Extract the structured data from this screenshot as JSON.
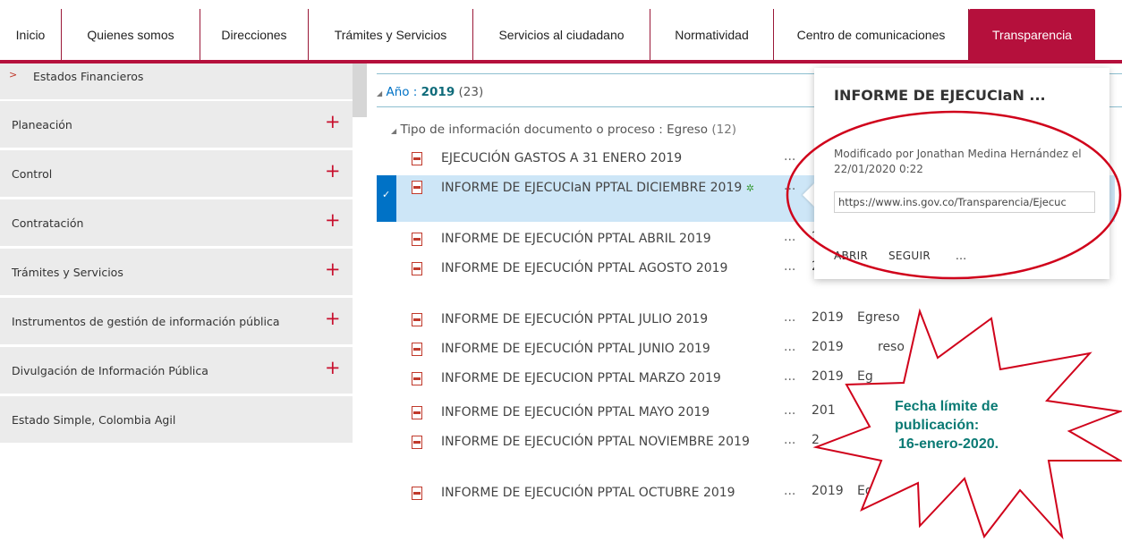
{
  "nav": {
    "items": [
      "Inicio",
      "Quienes somos",
      "Direcciones",
      "Trámites y Servicios",
      "Servicios al ciudadano",
      "Normatividad",
      "Centro de comunicaciones",
      "Transparencia"
    ],
    "active": "Transparencia",
    "accent_color": "#b5103c"
  },
  "sidebar": {
    "first": {
      "arrow": ">",
      "label": "Estados Financieros"
    },
    "items": [
      {
        "label": "Planeación",
        "expand": "+"
      },
      {
        "label": "Control",
        "expand": "+"
      },
      {
        "label": "Contratación",
        "expand": "+"
      },
      {
        "label": "Trámites y Servicios",
        "expand": "+"
      },
      {
        "label": "Instrumentos de gestión de información pública",
        "expand": "+"
      },
      {
        "label": "Divulgación de Información Pública",
        "expand": "+"
      },
      {
        "label": "Estado Simple, Colombia Agil",
        "expand": ""
      }
    ]
  },
  "list": {
    "year_group": {
      "caret": "◢",
      "label": "Año :",
      "value": "2019",
      "count": "(23)"
    },
    "type_group": {
      "caret": "◢",
      "text": "Tipo de información documento o proceso : Egreso",
      "count": "(12)"
    },
    "rows": [
      {
        "title": "EJECUCIÓN GASTOS A 31 ENERO 2019",
        "dots": "...",
        "year": "",
        "type": "",
        "selected": false
      },
      {
        "title": "INFORME DE EJECUCIaN PPTAL DICIEMBRE 2019",
        "new_mark": "✲",
        "dots": "...",
        "year": "",
        "type": "",
        "selected": true
      },
      {
        "title": "INFORME DE EJECUCIÓN PPTAL ABRIL 2019",
        "dots": "...",
        "year": "2",
        "type": "",
        "selected": false
      },
      {
        "title": "INFORME DE EJECUCIÓN PPTAL AGOSTO 2019",
        "dots": "...",
        "year": "2",
        "type": "",
        "selected": false
      },
      {
        "title": "INFORME DE EJECUCIÓN PPTAL JULIO 2019",
        "dots": "...",
        "year": "2019",
        "type": "Egreso",
        "selected": false
      },
      {
        "title": "INFORME DE EJECUCIÓN PPTAL JUNIO 2019",
        "dots": "...",
        "year": "2019",
        "type": "reso",
        "selected": false
      },
      {
        "title": "INFORME DE EJECUCION PPTAL MARZO 2019",
        "dots": "...",
        "year": "2019",
        "type": "Eg",
        "selected": false
      },
      {
        "title": "INFORME DE EJECUCIÓN PPTAL MAYO 2019",
        "dots": "...",
        "year": "201",
        "type": "",
        "selected": false
      },
      {
        "title": "INFORME DE EJECUCIÓN PPTAL NOVIEMBRE 2019",
        "dots": "...",
        "year": "2",
        "type": "",
        "selected": false
      },
      {
        "title": "INFORME DE EJECUCIÓN PPTAL OCTUBRE 2019",
        "dots": "...",
        "year": "2019",
        "type": "Egres",
        "selected": false
      }
    ]
  },
  "callout": {
    "title": "INFORME DE EJECUCIaN ...",
    "modified": "Modificado por Jonathan Medina Hernández el 22/01/2020 0:22",
    "url": "https://www.ins.gov.co/Transparencia/Ejecuc",
    "open_label": "ABRIR",
    "follow_label": "SEGUIR",
    "more_label": "..."
  },
  "annotation": {
    "line1": "Fecha límite de",
    "line2": "publicación:",
    "line3": "16-enero-2020.",
    "text_color": "#0a7a74",
    "ellipse_color": "#d0021b"
  }
}
